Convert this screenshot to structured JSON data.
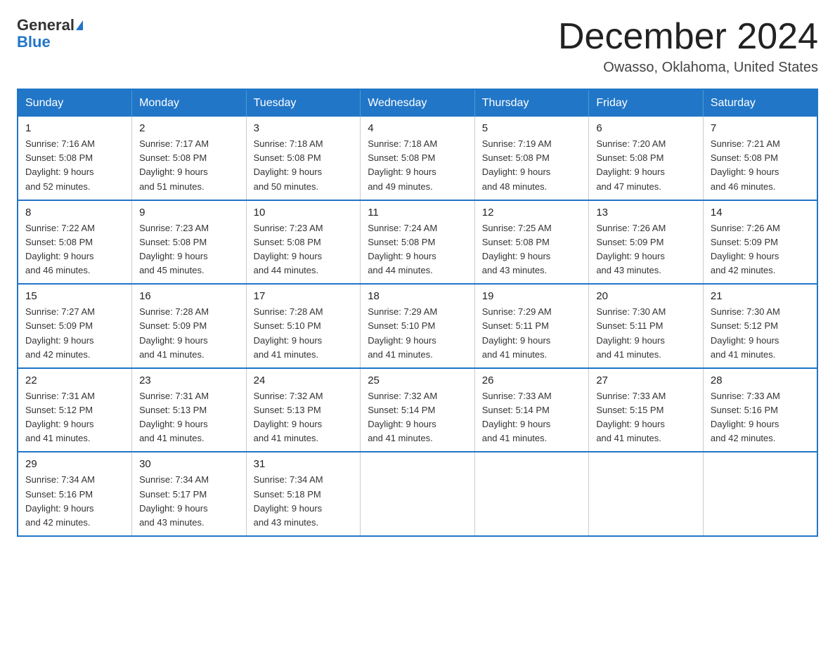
{
  "logo": {
    "general": "General",
    "blue": "Blue"
  },
  "title": "December 2024",
  "location": "Owasso, Oklahoma, United States",
  "weekdays": [
    "Sunday",
    "Monday",
    "Tuesday",
    "Wednesday",
    "Thursday",
    "Friday",
    "Saturday"
  ],
  "weeks": [
    [
      {
        "day": "1",
        "info": "Sunrise: 7:16 AM\nSunset: 5:08 PM\nDaylight: 9 hours\nand 52 minutes."
      },
      {
        "day": "2",
        "info": "Sunrise: 7:17 AM\nSunset: 5:08 PM\nDaylight: 9 hours\nand 51 minutes."
      },
      {
        "day": "3",
        "info": "Sunrise: 7:18 AM\nSunset: 5:08 PM\nDaylight: 9 hours\nand 50 minutes."
      },
      {
        "day": "4",
        "info": "Sunrise: 7:18 AM\nSunset: 5:08 PM\nDaylight: 9 hours\nand 49 minutes."
      },
      {
        "day": "5",
        "info": "Sunrise: 7:19 AM\nSunset: 5:08 PM\nDaylight: 9 hours\nand 48 minutes."
      },
      {
        "day": "6",
        "info": "Sunrise: 7:20 AM\nSunset: 5:08 PM\nDaylight: 9 hours\nand 47 minutes."
      },
      {
        "day": "7",
        "info": "Sunrise: 7:21 AM\nSunset: 5:08 PM\nDaylight: 9 hours\nand 46 minutes."
      }
    ],
    [
      {
        "day": "8",
        "info": "Sunrise: 7:22 AM\nSunset: 5:08 PM\nDaylight: 9 hours\nand 46 minutes."
      },
      {
        "day": "9",
        "info": "Sunrise: 7:23 AM\nSunset: 5:08 PM\nDaylight: 9 hours\nand 45 minutes."
      },
      {
        "day": "10",
        "info": "Sunrise: 7:23 AM\nSunset: 5:08 PM\nDaylight: 9 hours\nand 44 minutes."
      },
      {
        "day": "11",
        "info": "Sunrise: 7:24 AM\nSunset: 5:08 PM\nDaylight: 9 hours\nand 44 minutes."
      },
      {
        "day": "12",
        "info": "Sunrise: 7:25 AM\nSunset: 5:08 PM\nDaylight: 9 hours\nand 43 minutes."
      },
      {
        "day": "13",
        "info": "Sunrise: 7:26 AM\nSunset: 5:09 PM\nDaylight: 9 hours\nand 43 minutes."
      },
      {
        "day": "14",
        "info": "Sunrise: 7:26 AM\nSunset: 5:09 PM\nDaylight: 9 hours\nand 42 minutes."
      }
    ],
    [
      {
        "day": "15",
        "info": "Sunrise: 7:27 AM\nSunset: 5:09 PM\nDaylight: 9 hours\nand 42 minutes."
      },
      {
        "day": "16",
        "info": "Sunrise: 7:28 AM\nSunset: 5:09 PM\nDaylight: 9 hours\nand 41 minutes."
      },
      {
        "day": "17",
        "info": "Sunrise: 7:28 AM\nSunset: 5:10 PM\nDaylight: 9 hours\nand 41 minutes."
      },
      {
        "day": "18",
        "info": "Sunrise: 7:29 AM\nSunset: 5:10 PM\nDaylight: 9 hours\nand 41 minutes."
      },
      {
        "day": "19",
        "info": "Sunrise: 7:29 AM\nSunset: 5:11 PM\nDaylight: 9 hours\nand 41 minutes."
      },
      {
        "day": "20",
        "info": "Sunrise: 7:30 AM\nSunset: 5:11 PM\nDaylight: 9 hours\nand 41 minutes."
      },
      {
        "day": "21",
        "info": "Sunrise: 7:30 AM\nSunset: 5:12 PM\nDaylight: 9 hours\nand 41 minutes."
      }
    ],
    [
      {
        "day": "22",
        "info": "Sunrise: 7:31 AM\nSunset: 5:12 PM\nDaylight: 9 hours\nand 41 minutes."
      },
      {
        "day": "23",
        "info": "Sunrise: 7:31 AM\nSunset: 5:13 PM\nDaylight: 9 hours\nand 41 minutes."
      },
      {
        "day": "24",
        "info": "Sunrise: 7:32 AM\nSunset: 5:13 PM\nDaylight: 9 hours\nand 41 minutes."
      },
      {
        "day": "25",
        "info": "Sunrise: 7:32 AM\nSunset: 5:14 PM\nDaylight: 9 hours\nand 41 minutes."
      },
      {
        "day": "26",
        "info": "Sunrise: 7:33 AM\nSunset: 5:14 PM\nDaylight: 9 hours\nand 41 minutes."
      },
      {
        "day": "27",
        "info": "Sunrise: 7:33 AM\nSunset: 5:15 PM\nDaylight: 9 hours\nand 41 minutes."
      },
      {
        "day": "28",
        "info": "Sunrise: 7:33 AM\nSunset: 5:16 PM\nDaylight: 9 hours\nand 42 minutes."
      }
    ],
    [
      {
        "day": "29",
        "info": "Sunrise: 7:34 AM\nSunset: 5:16 PM\nDaylight: 9 hours\nand 42 minutes."
      },
      {
        "day": "30",
        "info": "Sunrise: 7:34 AM\nSunset: 5:17 PM\nDaylight: 9 hours\nand 43 minutes."
      },
      {
        "day": "31",
        "info": "Sunrise: 7:34 AM\nSunset: 5:18 PM\nDaylight: 9 hours\nand 43 minutes."
      },
      {
        "day": "",
        "info": ""
      },
      {
        "day": "",
        "info": ""
      },
      {
        "day": "",
        "info": ""
      },
      {
        "day": "",
        "info": ""
      }
    ]
  ]
}
